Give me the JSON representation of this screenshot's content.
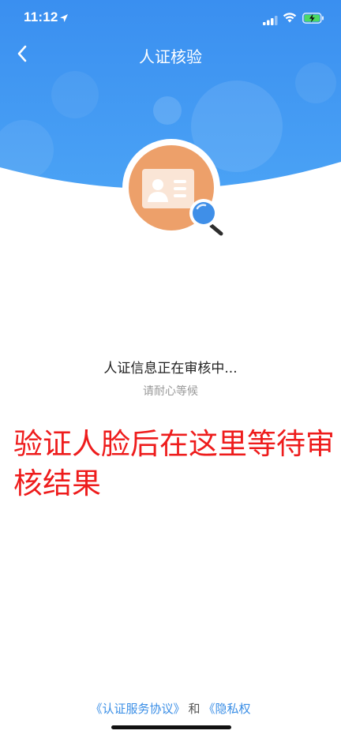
{
  "status_bar": {
    "time": "11:12"
  },
  "nav": {
    "title": "人证核验",
    "back_icon": "chevron-left-icon"
  },
  "illustration": {
    "icon": "id-card-magnifier-icon",
    "accent_color": "#EDA06A",
    "lens_color": "#3F8FE8"
  },
  "verification": {
    "status_title": "人证信息正在审核中...",
    "status_sub": "请耐心等候"
  },
  "annotation": {
    "text": "验证人脸后在这里等待审核结果",
    "color": "#EE1C1C"
  },
  "footer": {
    "link1": "《认证服务协议》",
    "conjunction": "和",
    "link2": "《隐私权"
  },
  "colors": {
    "header_blue": "#3D95F0",
    "link_blue": "#3A8EE6"
  }
}
